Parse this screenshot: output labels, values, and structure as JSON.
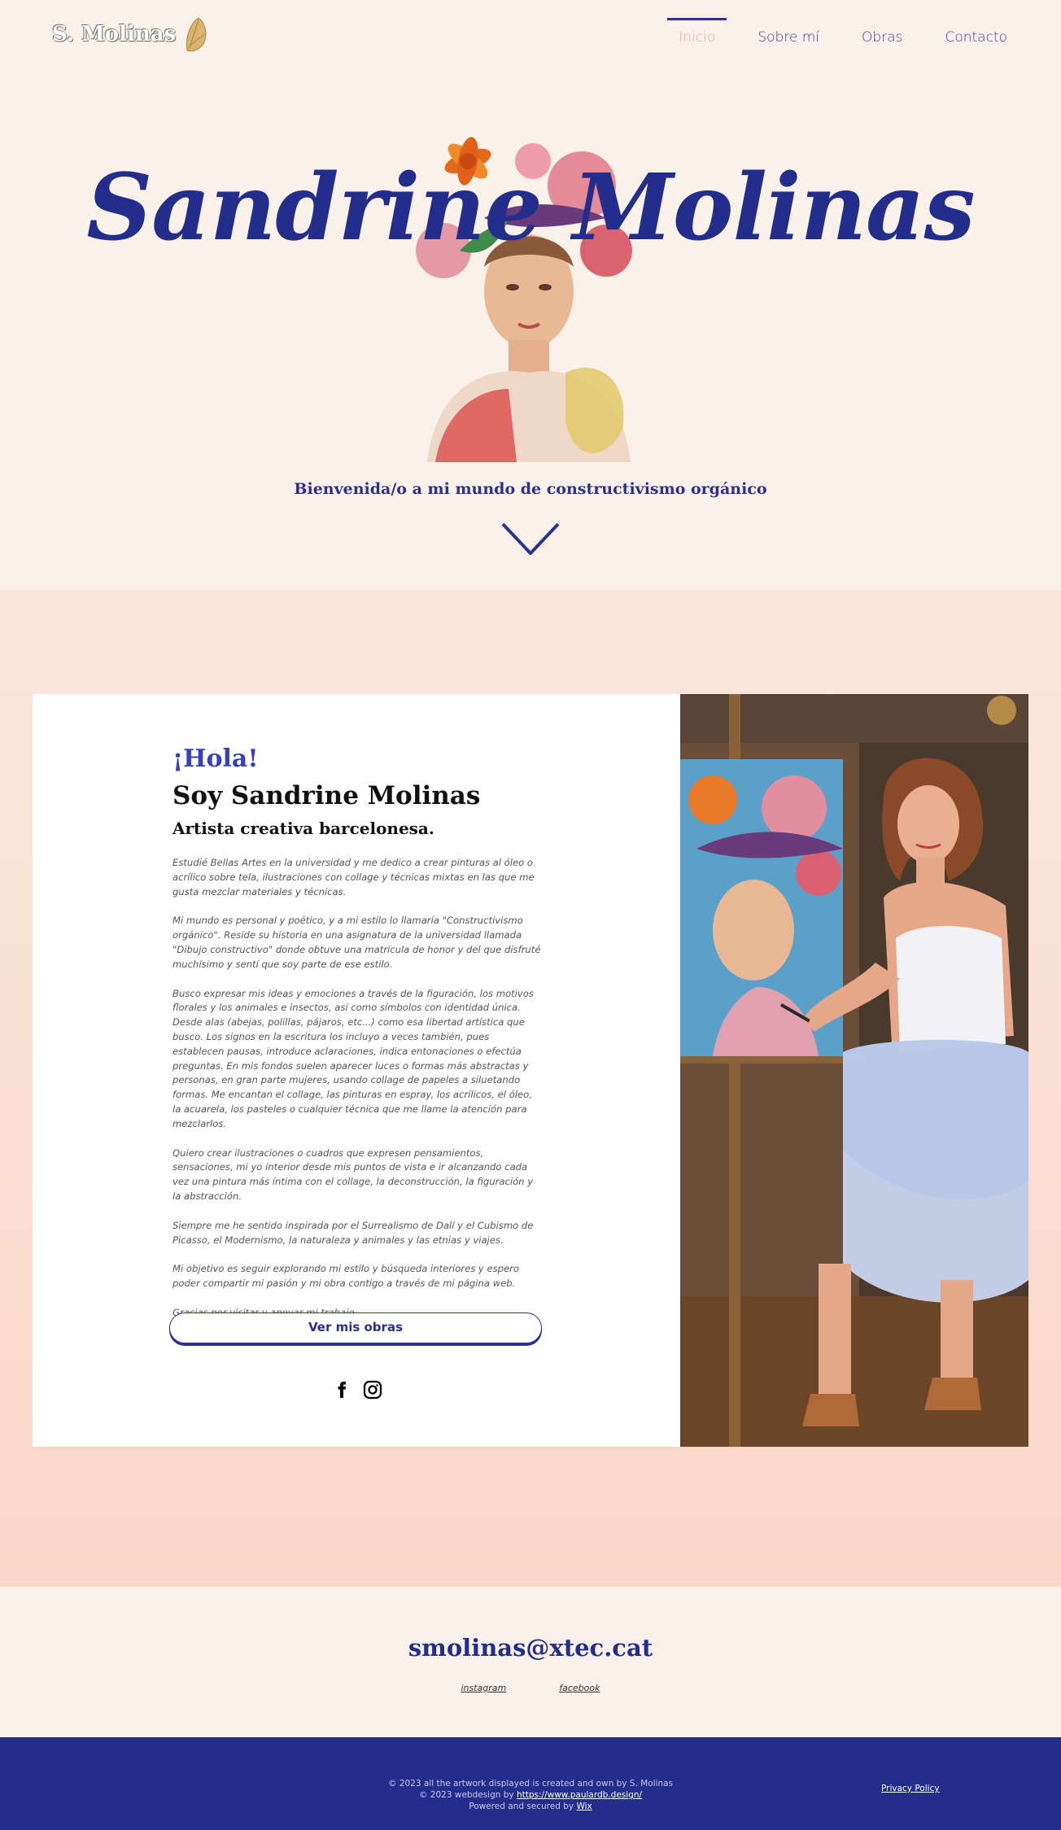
{
  "header": {
    "logo_text": "S. Molinas",
    "nav": [
      {
        "label": "Inicio",
        "active": true
      },
      {
        "label": "Sobre mí",
        "active": false
      },
      {
        "label": "Obras",
        "active": false
      },
      {
        "label": "Contacto",
        "active": false
      }
    ]
  },
  "hero": {
    "title": "Sandrine Molinas",
    "subtitle": "Bienvenida/o a mi mundo de constructivismo orgánico",
    "scroll_icon": "chevron-down-icon"
  },
  "about": {
    "greeting": "¡Hola!",
    "heading": "Soy Sandrine Molinas",
    "subheading": "Artista creativa barcelonesa.",
    "paragraphs": [
      "Estudié Bellas Artes en la universidad y me dedico a crear pinturas al óleo o acrílico sobre tela, ilustraciones con collage y técnicas mixtas en las que me gusta mezclar materiales y técnicas.",
      "Mi mundo es personal y poético, y a mi estilo lo llamaría \"Constructivismo orgánico\". Reside su historia en una asignatura de la universidad llamada \"Dibujo constructivo\" donde obtuve una matrícula de honor y del que disfruté muchísimo y sentí que soy parte de ese estilo.",
      "Busco expresar mis ideas y emociones a través de la figuración, los motivos florales y los animales e insectos, así como símbolos con identidad única. Desde alas (abejas, polillas, pájaros, etc...) como esa libertad artística que busco. Los signos en la escritura los incluyo a veces también, pues establecen pausas, introduce aclaraciones, indica entonaciones o efectúa preguntas. En mis fondos suelen aparecer luces o formas más abstractas y personas, en gran parte mujeres, usando collage de papeles a siluetando formas. Me encantan el collage, las pinturas en espray, los acrílicos, el óleo, la acuarela, los pasteles o cualquier técnica que me llame la atención para mezclarlos.",
      "Quiero crear ilustraciones o cuadros que expresen pensamientos, sensaciones, mi yo interior desde mis puntos de vista e ir alcanzando cada vez una pintura más íntima con el collage, la deconstrucción, la figuración y la abstracción.",
      "Siempre me he sentido inspirada por el Surrealismo de Dalí y el Cubismo de Picasso, el Modernismo, la naturaleza y animales y las etnias y viajes.",
      "Mi objetivo es seguir explorando mi estilo y búsqueda interiores y espero poder compartir mi pasión y mi obra contigo a través de mi página web.",
      "Gracias por visitar y apoyar mi trabajo."
    ],
    "cta_label": "Ver mis obras",
    "socials": [
      {
        "icon": "facebook-icon"
      },
      {
        "icon": "instagram-icon"
      }
    ]
  },
  "contact": {
    "email": "smolinas@xtec.cat",
    "links": [
      "instagram",
      "facebook"
    ]
  },
  "footer": {
    "line1": "© 2023 all the artwork displayed is created and own by S. Molinas",
    "line2_prefix": "© 2023 webdesign  by ",
    "line2_link": "https://www.paulardb.design/",
    "line3_prefix": "Powered and secured by ",
    "line3_link": "Wix",
    "privacy": "Privacy Policy"
  },
  "colors": {
    "brand_blue": "#222d8c",
    "accent_pink": "#f4a3a3",
    "background": "#faf1ea"
  }
}
